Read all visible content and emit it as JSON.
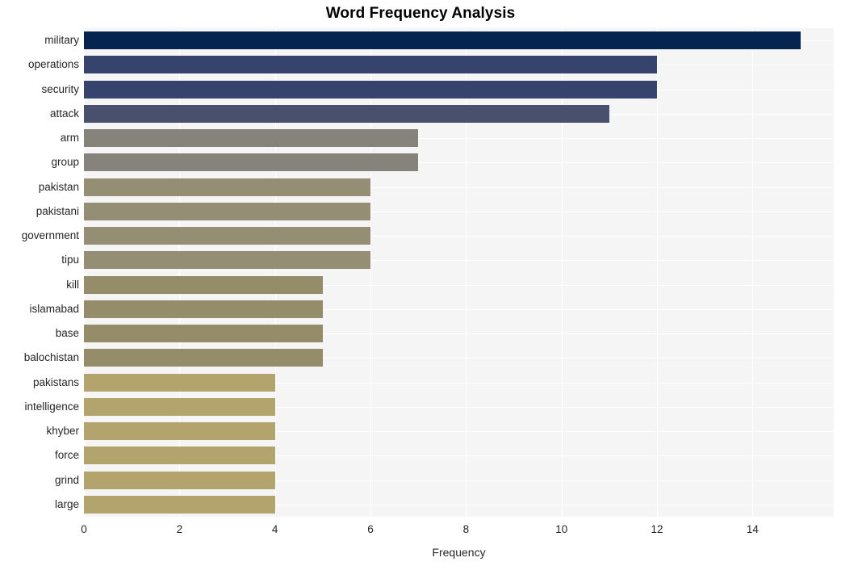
{
  "chart_data": {
    "type": "bar",
    "orientation": "horizontal",
    "title": "Word Frequency Analysis",
    "xlabel": "Frequency",
    "ylabel": "",
    "categories": [
      "military",
      "operations",
      "security",
      "attack",
      "arm",
      "group",
      "pakistan",
      "pakistani",
      "government",
      "tipu",
      "kill",
      "islamabad",
      "base",
      "balochistan",
      "pakistans",
      "intelligence",
      "khyber",
      "force",
      "grind",
      "large"
    ],
    "values": [
      15,
      12,
      12,
      11,
      7,
      7,
      6,
      6,
      6,
      6,
      5,
      5,
      5,
      5,
      4,
      4,
      4,
      4,
      4,
      4
    ],
    "bar_colors": [
      "#05244f",
      "#36436c",
      "#36436c",
      "#48506e",
      "#85837c",
      "#85837c",
      "#938e74",
      "#938e74",
      "#938e74",
      "#938e74",
      "#958d69",
      "#958d69",
      "#958d69",
      "#958d69",
      "#b2a46c",
      "#b2a46c",
      "#b2a46c",
      "#b2a46c",
      "#b2a46c",
      "#b2a46c"
    ],
    "xlim": [
      0,
      15.7
    ],
    "xticks": [
      0,
      2,
      4,
      6,
      8,
      10,
      12,
      14
    ],
    "xtick_labels": [
      "0",
      "2",
      "4",
      "6",
      "8",
      "10",
      "12",
      "14"
    ],
    "grid": true,
    "grid_color": "#ffffff",
    "plot_background": "#f5f5f5",
    "figure_background": "#ffffff",
    "legend": null,
    "title_color": "#000000",
    "tick_color": "#262626"
  }
}
